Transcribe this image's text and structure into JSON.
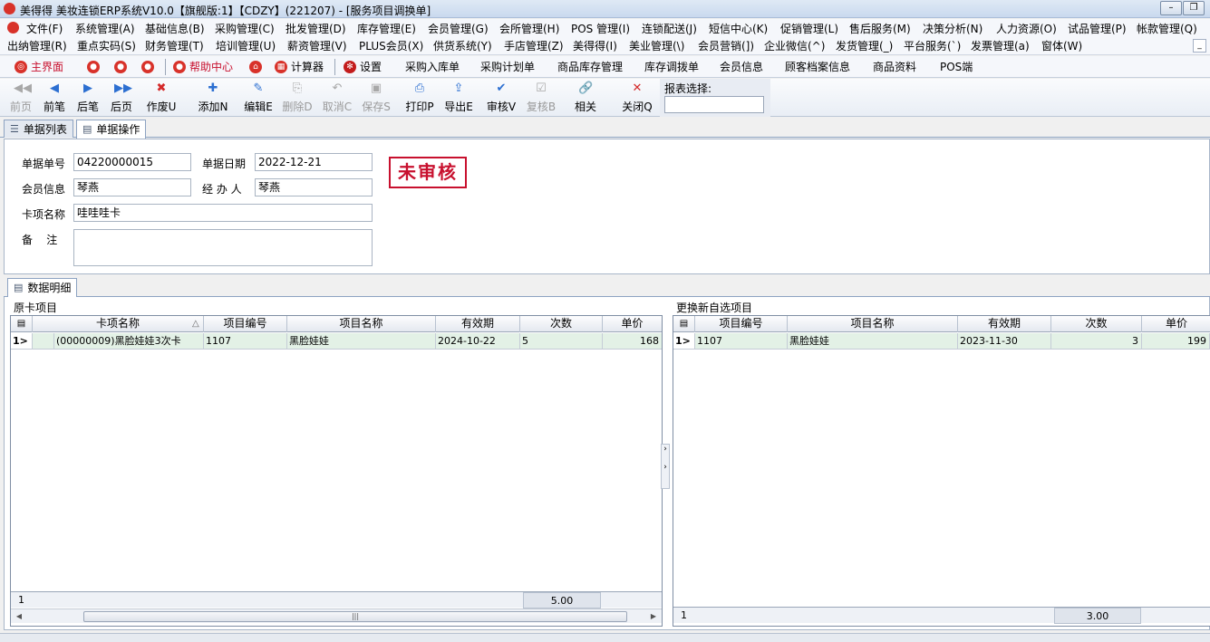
{
  "window": {
    "title": "美得得 美妆连锁ERP系统V10.0【旗舰版:1】【CDZY】(221207) - [服务项目调换单]",
    "min": "–",
    "restore": "❐",
    "close": "✕"
  },
  "menu": {
    "row1": [
      "文件(F)",
      "系统管理(A)",
      "基础信息(B)",
      "采购管理(C)",
      "批发管理(D)",
      "库存管理(E)",
      "会员管理(G)",
      "会所管理(H)",
      "POS 管理(I)",
      "连锁配送(J)",
      "短信中心(K)",
      "促销管理(L)",
      "售后服务(M)",
      "决策分析(N)",
      "人力资源(O)",
      "试品管理(P)",
      "帐款管理(Q)"
    ],
    "row2": [
      "出纳管理(R)",
      "重点实码(S)",
      "财务管理(T)",
      "培训管理(U)",
      "薪资管理(V)",
      "PLUS会员(X)",
      "供货系统(Y)",
      "手店管理(Z)",
      "美得得(I)",
      "美业管理(\\)",
      "会员营销(])",
      "企业微信(^)",
      "发货管理(_)",
      "平台服务(`)",
      "发票管理(a)",
      "窗体(W)"
    ],
    "mdi_min": "_",
    "mdi_close": "×"
  },
  "quickbar": {
    "home": "主界面",
    "help": "帮助中心",
    "calc": "计算器",
    "settings": "设置",
    "links": [
      "采购入库单",
      "采购计划单",
      "商品库存管理",
      "库存调拨单",
      "会员信息",
      "顾客档案信息",
      "商品资料",
      "POS端"
    ]
  },
  "toolbar": {
    "buttons": [
      {
        "label": "前页",
        "icon": "◀◀"
      },
      {
        "label": "前笔",
        "icon": "◀"
      },
      {
        "label": "后笔",
        "icon": "▶"
      },
      {
        "label": "后页",
        "icon": "▶▶"
      },
      {
        "label": "作废U",
        "icon": "✖"
      },
      {
        "label": "添加N",
        "icon": "✚"
      },
      {
        "label": "编辑E",
        "icon": "✎"
      },
      {
        "label": "删除D",
        "icon": "⎘"
      },
      {
        "label": "取消C",
        "icon": "↶"
      },
      {
        "label": "保存S",
        "icon": "▣"
      },
      {
        "label": "打印P",
        "icon": "⎙"
      },
      {
        "label": "导出E",
        "icon": "⇪"
      },
      {
        "label": "审核V",
        "icon": "✔"
      },
      {
        "label": "复核B",
        "icon": "☑"
      },
      {
        "label": "相关",
        "icon": "🔗"
      },
      {
        "label": "关闭Q",
        "icon": "✕"
      }
    ],
    "report_label": "报表选择:"
  },
  "tabs": {
    "list": "单据列表",
    "operation": "单据操作"
  },
  "form": {
    "doc_no_label": "单据单号",
    "doc_no": "04220000015",
    "doc_date_label": "单据日期",
    "doc_date": "2022-12-21",
    "member_label": "会员信息",
    "member": "琴燕",
    "handler_label": "经 办 人",
    "handler": "琴燕",
    "card_label": "卡项名称",
    "card": "哇哇哇卡",
    "remark_label": "备    注",
    "remark": "",
    "status_stamp": "未审核"
  },
  "detail": {
    "tab": "数据明细",
    "left_group": "原卡项目",
    "right_group": "更换新自选项目",
    "left_headers": [
      "",
      "卡项名称",
      "项目编号",
      "项目名称",
      "有效期",
      "次数",
      "单价"
    ],
    "left_rows": [
      {
        "ind": "1>",
        "card": "(00000009)黑脸娃娃3次卡",
        "code": "1107",
        "name": "黑脸娃娃",
        "expiry": "2024-10-22",
        "times": "5",
        "price": "168"
      }
    ],
    "left_footer_count": "1",
    "left_footer_total": "5.00",
    "right_headers": [
      "",
      "项目编号",
      "项目名称",
      "有效期",
      "次数",
      "单价"
    ],
    "right_rows": [
      {
        "ind": "1>",
        "code": "1107",
        "name": "黑脸娃娃",
        "expiry": "2023-11-30",
        "times": "3",
        "price": "199"
      }
    ],
    "right_footer_count": "1",
    "right_footer_total": "3.00",
    "sort_indicator": "△"
  }
}
